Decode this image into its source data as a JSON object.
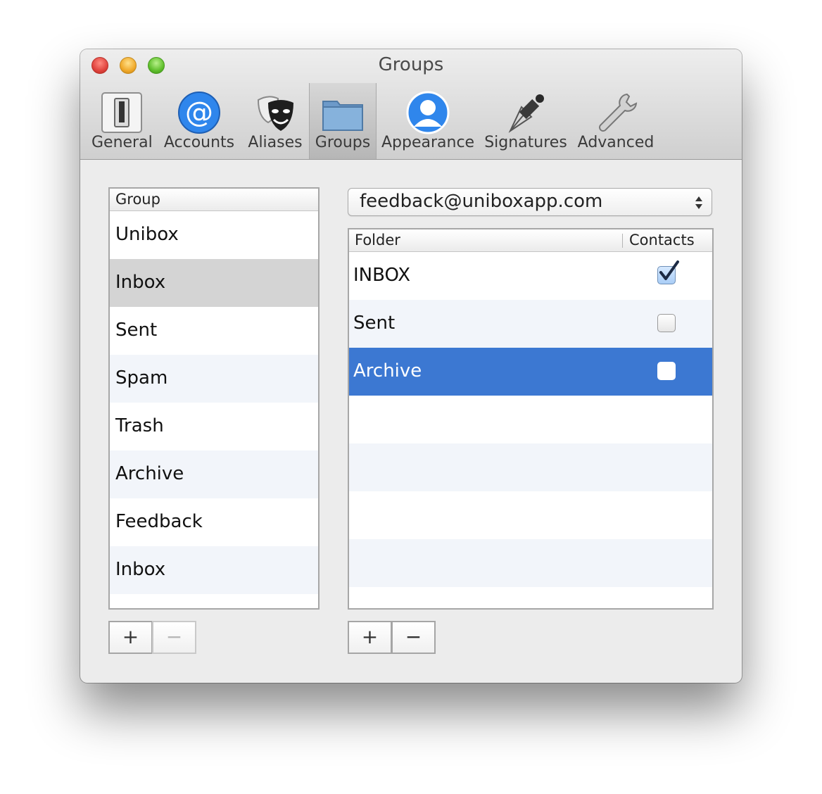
{
  "window": {
    "title": "Groups"
  },
  "toolbar": {
    "items": [
      {
        "label": "General",
        "icon": "switch-icon"
      },
      {
        "label": "Accounts",
        "icon": "at-sign-icon"
      },
      {
        "label": "Aliases",
        "icon": "theater-masks-icon"
      },
      {
        "label": "Groups",
        "icon": "folder-icon",
        "selected": true
      },
      {
        "label": "Appearance",
        "icon": "person-icon"
      },
      {
        "label": "Signatures",
        "icon": "fountain-pen-icon"
      },
      {
        "label": "Advanced",
        "icon": "wrench-icon"
      }
    ]
  },
  "groups": {
    "header": "Group",
    "rows": [
      "Unibox",
      "Inbox",
      "Sent",
      "Spam",
      "Trash",
      "Archive",
      "Feedback",
      "Inbox"
    ],
    "selected_index": 1,
    "add_label": "+",
    "remove_label": "−"
  },
  "account_select": {
    "value": "feedback@uniboxapp.com"
  },
  "folders": {
    "header_folder": "Folder",
    "header_contacts": "Contacts",
    "rows": [
      {
        "name": "INBOX",
        "contacts": true
      },
      {
        "name": "Sent",
        "contacts": false
      },
      {
        "name": "Archive",
        "contacts": false
      }
    ],
    "selected_index": 2,
    "add_label": "+",
    "remove_label": "−"
  },
  "colors": {
    "selection": "#3c78d2",
    "row_alt": "#f2f5fa",
    "group_selected": "#d4d4d4"
  }
}
